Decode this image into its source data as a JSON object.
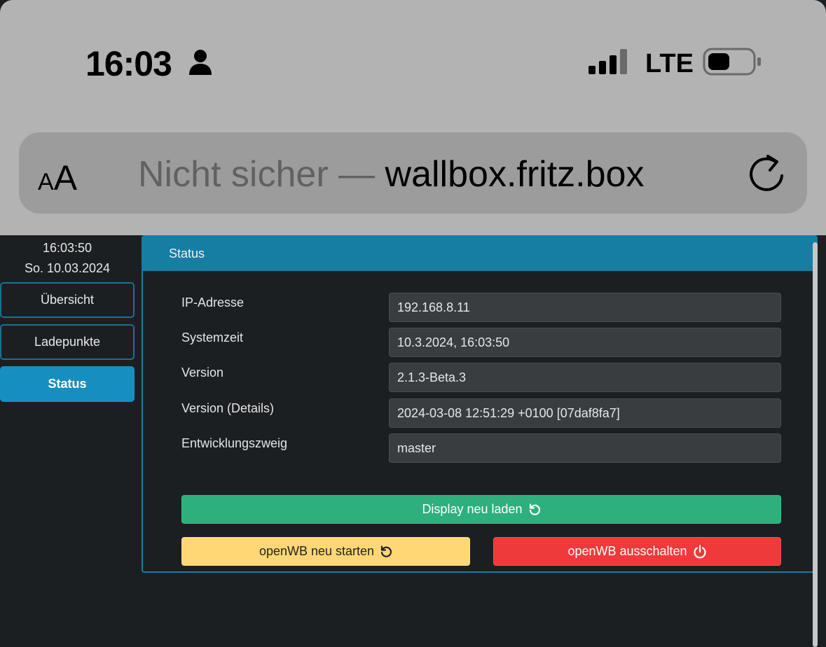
{
  "status_bar": {
    "time": "16:03",
    "network": "LTE",
    "icons": [
      "person-icon",
      "signal-icon",
      "battery-icon"
    ]
  },
  "address_bar": {
    "aa_label_small": "A",
    "aa_label_big": "A",
    "insecure_text": "Nicht sicher — ",
    "host": "wallbox.fritz.box",
    "reload_icon": "reload-icon"
  },
  "sidebar": {
    "time": "16:03:50",
    "date": "So. 10.03.2024",
    "items": [
      {
        "label": "Übersicht",
        "active": false
      },
      {
        "label": "Ladepunkte",
        "active": false
      },
      {
        "label": "Status",
        "active": true
      }
    ]
  },
  "status_card": {
    "title": "Status",
    "rows": [
      {
        "label": "IP-Adresse",
        "value": "192.168.8.11"
      },
      {
        "label": "Systemzeit",
        "value": "10.3.2024, 16:03:50"
      },
      {
        "label": "Version",
        "value": "2.1.3-Beta.3"
      },
      {
        "label": "Version (Details)",
        "value": "2024-03-08 12:51:29 +0100 [07daf8fa7]"
      },
      {
        "label": "Entwicklungszweig",
        "value": "master"
      }
    ],
    "buttons": {
      "display_reload": "Display neu laden",
      "restart": "openWB neu starten",
      "shutdown": "openWB ausschalten"
    }
  },
  "colors": {
    "accent": "#167ea3",
    "active_nav": "#168fc0",
    "success": "#2db07c",
    "warning": "#ffd775",
    "danger": "#ee3a3a",
    "background": "#1c1f22"
  }
}
